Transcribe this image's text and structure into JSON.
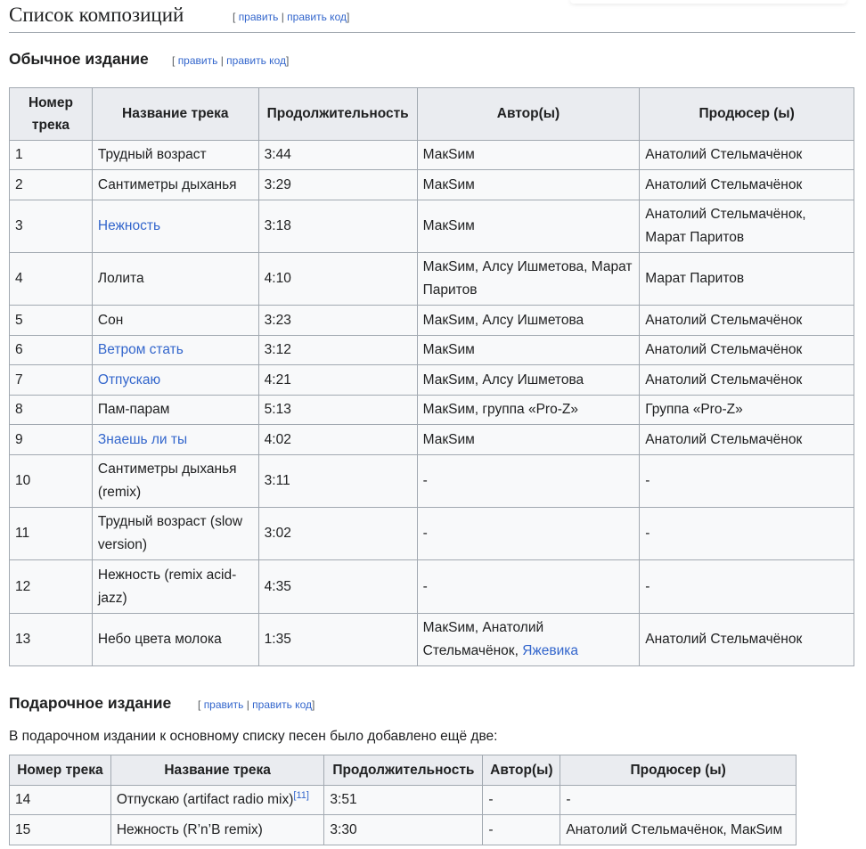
{
  "section": {
    "title": "Список композиций",
    "edit": {
      "open": "[",
      "edit": "править",
      "sep": "|",
      "edit_code": "править код",
      "close": "]"
    }
  },
  "regular": {
    "heading": "Обычное издание",
    "headers": [
      "Номер трека",
      "Название трека",
      "Продолжительность",
      "Автор(ы)",
      "Продюсер (ы)"
    ],
    "rows": [
      [
        "1",
        "Трудный возраст",
        "3:44",
        "МакSим",
        "Анатолий Стельмачёнок"
      ],
      [
        "2",
        "Сантиметры дыханья",
        "3:29",
        "МакSим",
        "Анатолий Стельмачёнок"
      ],
      [
        "3",
        "Нежность",
        "3:18",
        "МакSим",
        "Анатолий Стельмачёнок, Марат Паритов"
      ],
      [
        "4",
        "Лолита",
        "4:10",
        "МакSим, Алсу Ишметова, Марат Паритов",
        "Марат Паритов"
      ],
      [
        "5",
        "Сон",
        "3:23",
        "МакSим, Алсу Ишметова",
        "Анатолий Стельмачёнок"
      ],
      [
        "6",
        "Ветром стать",
        "3:12",
        "МакSим",
        "Анатолий Стельмачёнок"
      ],
      [
        "7",
        "Отпускаю",
        "4:21",
        "МакSим, Алсу Ишметова",
        "Анатолий Стельмачёнок"
      ],
      [
        "8",
        "Пам-парам",
        "5:13",
        "МакSим, группа «Pro-Z»",
        "Группа «Pro-Z»"
      ],
      [
        "9",
        "Знаешь ли ты",
        "4:02",
        "МакSим",
        "Анатолий Стельмачёнок"
      ],
      [
        "10",
        "Сантиметры дыханья (remix)",
        "3:11",
        "-",
        "-"
      ],
      [
        "11",
        "Трудный возраст (slow version)",
        "3:02",
        "-",
        "-"
      ],
      [
        "12",
        "Нежность (remix acid-jazz)",
        "4:35",
        "-",
        "-"
      ],
      [
        "13",
        "Небо цвета молока",
        "1:35",
        "МакSим, Анатолий Стельмачёнок, ",
        "Анатолий Стельмачёнок"
      ]
    ],
    "row13_author_link": "Яжевика"
  },
  "gift": {
    "heading": "Подарочное издание",
    "intro": "В подарочном издании к основному списку песен было добавлено ещё две:",
    "headers": [
      "Номер трека",
      "Название трека",
      "Продолжительность",
      "Автор(ы)",
      "Продюсер (ы)"
    ],
    "rows": [
      [
        "14",
        "Отпускаю (artifact radio mix)",
        "3:51",
        "-",
        "-"
      ],
      [
        "15",
        "Нежность (R’n’B remix)",
        "3:30",
        "-",
        "Анатолий Стельмачёнок, МакSим"
      ]
    ],
    "row14_ref": "[11]"
  },
  "colors": {
    "link": "#3366cc",
    "border": "#a2a9b1",
    "header_bg": "#eaecf0",
    "cell_bg": "#f8f9fa"
  }
}
